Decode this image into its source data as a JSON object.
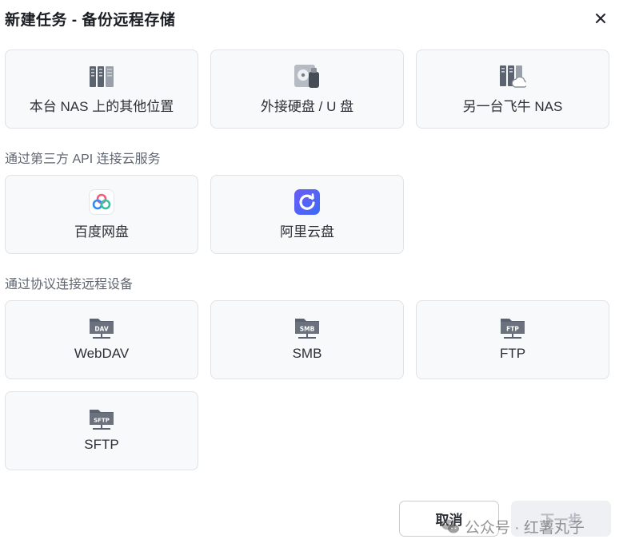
{
  "dialog": {
    "title": "新建任务 - 备份远程存储"
  },
  "groups": [
    {
      "title": "",
      "cards": [
        {
          "label": "本台 NAS 上的其他位置",
          "icon": "server-rack-icon"
        },
        {
          "label": "外接硬盘 / U 盘",
          "icon": "external-drive-icon"
        },
        {
          "label": "另一台飞牛 NAS",
          "icon": "nas-cloud-icon"
        }
      ]
    },
    {
      "title": "通过第三方 API 连接云服务",
      "cards": [
        {
          "label": "百度网盘",
          "icon": "baidu-netdisk-icon"
        },
        {
          "label": "阿里云盘",
          "icon": "aliyun-drive-icon"
        }
      ]
    },
    {
      "title": "通过协议连接远程设备",
      "cards": [
        {
          "label": "WebDAV",
          "icon": "webdav-folder-icon",
          "badge": "DAV"
        },
        {
          "label": "SMB",
          "icon": "smb-folder-icon",
          "badge": "SMB"
        },
        {
          "label": "FTP",
          "icon": "ftp-folder-icon",
          "badge": "FTP"
        },
        {
          "label": "SFTP",
          "icon": "sftp-folder-icon",
          "badge": "SFTP"
        }
      ]
    }
  ],
  "footer": {
    "cancel_label": "取消",
    "next_label": "下一步"
  },
  "watermark": {
    "text": "公众号 · 红薯丸子"
  },
  "colors": {
    "card_bg": "#f8f9fb",
    "card_border": "#dfe2e7",
    "icon_gray": "#5c6370",
    "baidu_blue": "#2f8cf5",
    "aliyun_blue": "#4b5bf5"
  }
}
